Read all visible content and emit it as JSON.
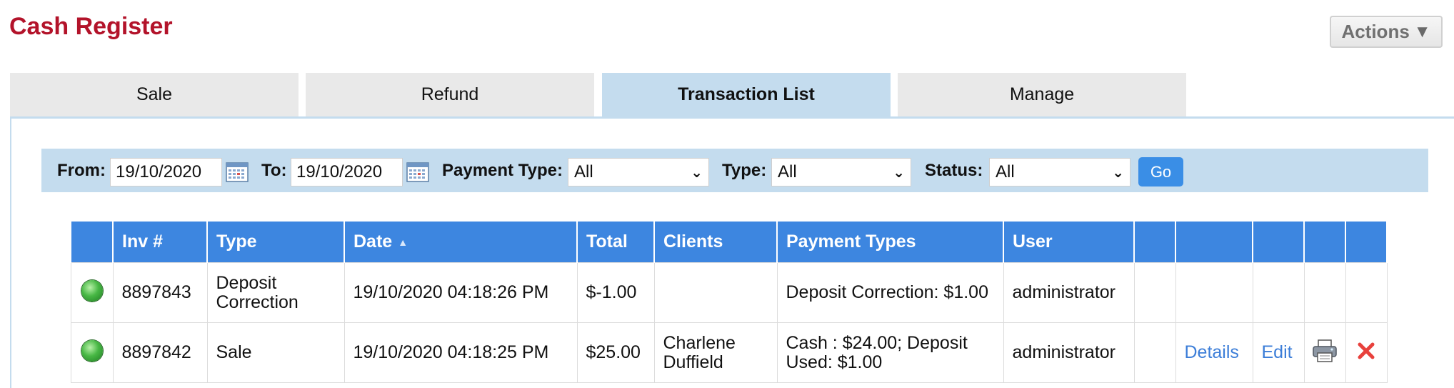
{
  "header": {
    "title": "Cash Register",
    "actions_label": "Actions"
  },
  "tabs": [
    {
      "label": "Sale",
      "active": false
    },
    {
      "label": "Refund",
      "active": false
    },
    {
      "label": "Transaction List",
      "active": true
    },
    {
      "label": "Manage",
      "active": false
    }
  ],
  "filters": {
    "from_label": "From:",
    "from_value": "19/10/2020",
    "to_label": "To:",
    "to_value": "19/10/2020",
    "payment_type_label": "Payment Type:",
    "payment_type_value": "All",
    "type_label": "Type:",
    "type_value": "All",
    "status_label": "Status:",
    "status_value": "All",
    "go_label": "Go"
  },
  "table": {
    "headers": [
      "",
      "Inv #",
      "Type",
      "Date",
      "Total",
      "Clients",
      "Payment Types",
      "User",
      "",
      "",
      "",
      "",
      ""
    ],
    "rows": [
      {
        "status_color": "#47b744",
        "inv": "8897843",
        "type": "Deposit Correction",
        "date": "19/10/2020 04:18:26 PM",
        "total": "$-1.00",
        "clients": "",
        "payment_types": "Deposit Correction: $1.00",
        "user": "administrator"
      },
      {
        "status_color": "#47b744",
        "inv": "8897842",
        "type": "Sale",
        "date": "19/10/2020 04:18:25 PM",
        "total": "$25.00",
        "clients": "Charlene Duffield",
        "payment_types": "Cash : $24.00; Deposit Used: $1.00",
        "user": "administrator",
        "details_label": "Details",
        "edit_label": "Edit"
      }
    ]
  }
}
